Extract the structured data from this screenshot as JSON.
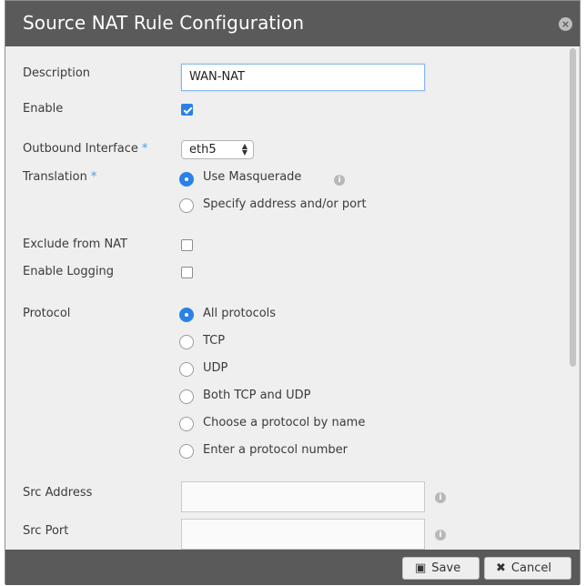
{
  "dialog": {
    "title": "Source NAT Rule Configuration",
    "close_glyph": "×"
  },
  "form": {
    "description": {
      "label": "Description",
      "value": "WAN-NAT"
    },
    "enable": {
      "label": "Enable",
      "checked": true
    },
    "outbound_interface": {
      "label": "Outbound Interface",
      "required_mark": "*",
      "value": "eth5"
    },
    "translation": {
      "label": "Translation",
      "required_mark": "*",
      "options": [
        "Use Masquerade",
        "Specify address and/or port"
      ],
      "selected": "Use Masquerade"
    },
    "exclude_from_nat": {
      "label": "Exclude from NAT",
      "checked": false
    },
    "enable_logging": {
      "label": "Enable Logging",
      "checked": false
    },
    "protocol": {
      "label": "Protocol",
      "options": [
        "All protocols",
        "TCP",
        "UDP",
        "Both TCP and UDP",
        "Choose a protocol by name",
        "Enter a protocol number"
      ],
      "selected": "All protocols"
    },
    "src_address": {
      "label": "Src Address",
      "value": ""
    },
    "src_port": {
      "label": "Src Port",
      "value": ""
    }
  },
  "footer": {
    "save_label": "Save",
    "cancel_label": "Cancel",
    "save_icon": "save-icon",
    "cancel_icon": "x-icon"
  },
  "colors": {
    "titlebar": "#5a5a5a",
    "accent": "#2a81e8",
    "body": "#efefef"
  }
}
